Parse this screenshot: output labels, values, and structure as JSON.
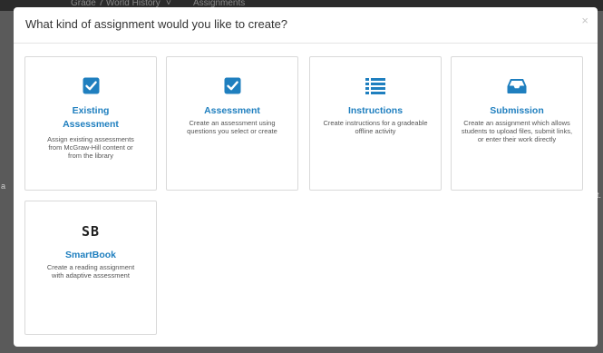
{
  "backdrop": {
    "breadcrumb_course": "Grade 7 World History",
    "breadcrumb_chevron": "˅",
    "breadcrumb_section": "Assignments",
    "side_left": "a",
    "side_right": "at."
  },
  "modal": {
    "title": "What kind of assignment would you like to create?",
    "close_label": "×"
  },
  "cards": [
    {
      "icon": "checkbox-icon",
      "title": "Existing Assessment",
      "desc": "Assign existing assessments from McGraw-Hill content or from the library"
    },
    {
      "icon": "checkbox-icon",
      "title": "Assessment",
      "desc": "Create an assessment using questions you select or create"
    },
    {
      "icon": "list-icon",
      "title": "Instructions",
      "desc": "Create instructions for a gradeable offline activity"
    },
    {
      "icon": "inbox-tray-icon",
      "title": "Submission",
      "desc": "Create an assignment which allows students to upload files, submit links, or enter their work directly"
    },
    {
      "icon": "smartbook-logo-icon",
      "logo_text": "SB",
      "title": "SmartBook",
      "desc": "Create a reading assignment with adaptive assessment"
    }
  ],
  "colors": {
    "accent": "#1f7fbf",
    "card_border": "#d9d9d9",
    "backdrop": "#5a5a5a"
  }
}
